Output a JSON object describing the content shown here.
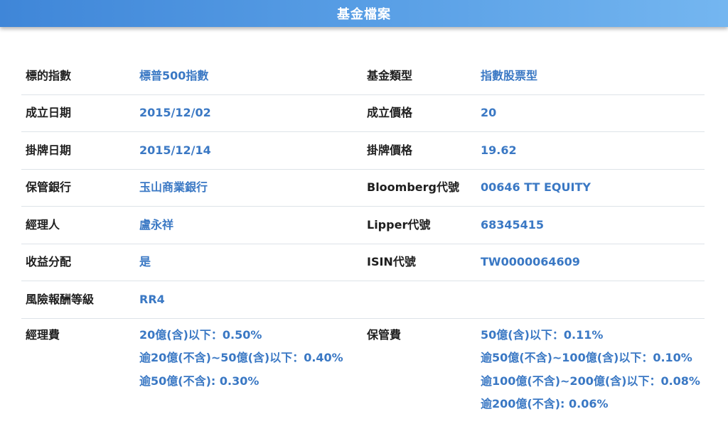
{
  "header": {
    "title": "基金檔案"
  },
  "rows": [
    {
      "label1": "標的指數",
      "value1": "標普500指數",
      "label2": "基金類型",
      "value2": "指數股票型"
    },
    {
      "label1": "成立日期",
      "value1": "2015/12/02",
      "label2": "成立價格",
      "value2": "20"
    },
    {
      "label1": "掛牌日期",
      "value1": "2015/12/14",
      "label2": "掛牌價格",
      "value2": "19.62"
    },
    {
      "label1": "保管銀行",
      "value1": "玉山商業銀行",
      "label2": "Bloomberg代號",
      "value2": "00646 TT EQUITY"
    },
    {
      "label1": "經理人",
      "value1": "盧永祥",
      "label2": "Lipper代號",
      "value2": "68345415"
    },
    {
      "label1": "收益分配",
      "value1": "是",
      "label2": "ISIN代號",
      "value2": "TW0000064609"
    },
    {
      "label1": "風險報酬等級",
      "value1": "RR4",
      "label2": "",
      "value2": ""
    }
  ],
  "fees": {
    "mgmt_label": "經理費",
    "mgmt_lines": [
      "20億(含)以下：0.50%",
      "逾20億(不含)~50億(含)以下：0.40%",
      "逾50億(不含): 0.30%"
    ],
    "custody_label": "保管費",
    "custody_lines": [
      "50億(含)以下：0.11%",
      "逾50億(不含)~100億(含)以下：0.10%",
      "逾100億(不含)~200億(含)以下：0.08%",
      "逾200億(不含): 0.06%"
    ]
  }
}
